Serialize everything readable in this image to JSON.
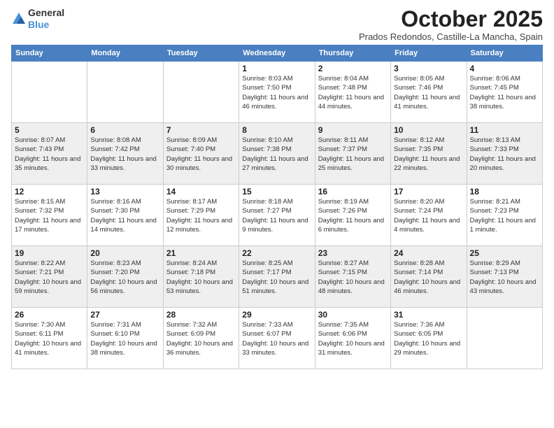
{
  "header": {
    "logo_line1": "General",
    "logo_line2": "Blue",
    "month": "October 2025",
    "location": "Prados Redondos, Castille-La Mancha, Spain"
  },
  "weekdays": [
    "Sunday",
    "Monday",
    "Tuesday",
    "Wednesday",
    "Thursday",
    "Friday",
    "Saturday"
  ],
  "weeks": [
    [
      {
        "day": "",
        "info": ""
      },
      {
        "day": "",
        "info": ""
      },
      {
        "day": "",
        "info": ""
      },
      {
        "day": "1",
        "info": "Sunrise: 8:03 AM\nSunset: 7:50 PM\nDaylight: 11 hours and 46 minutes."
      },
      {
        "day": "2",
        "info": "Sunrise: 8:04 AM\nSunset: 7:48 PM\nDaylight: 11 hours and 44 minutes."
      },
      {
        "day": "3",
        "info": "Sunrise: 8:05 AM\nSunset: 7:46 PM\nDaylight: 11 hours and 41 minutes."
      },
      {
        "day": "4",
        "info": "Sunrise: 8:06 AM\nSunset: 7:45 PM\nDaylight: 11 hours and 38 minutes."
      }
    ],
    [
      {
        "day": "5",
        "info": "Sunrise: 8:07 AM\nSunset: 7:43 PM\nDaylight: 11 hours and 35 minutes."
      },
      {
        "day": "6",
        "info": "Sunrise: 8:08 AM\nSunset: 7:42 PM\nDaylight: 11 hours and 33 minutes."
      },
      {
        "day": "7",
        "info": "Sunrise: 8:09 AM\nSunset: 7:40 PM\nDaylight: 11 hours and 30 minutes."
      },
      {
        "day": "8",
        "info": "Sunrise: 8:10 AM\nSunset: 7:38 PM\nDaylight: 11 hours and 27 minutes."
      },
      {
        "day": "9",
        "info": "Sunrise: 8:11 AM\nSunset: 7:37 PM\nDaylight: 11 hours and 25 minutes."
      },
      {
        "day": "10",
        "info": "Sunrise: 8:12 AM\nSunset: 7:35 PM\nDaylight: 11 hours and 22 minutes."
      },
      {
        "day": "11",
        "info": "Sunrise: 8:13 AM\nSunset: 7:33 PM\nDaylight: 11 hours and 20 minutes."
      }
    ],
    [
      {
        "day": "12",
        "info": "Sunrise: 8:15 AM\nSunset: 7:32 PM\nDaylight: 11 hours and 17 minutes."
      },
      {
        "day": "13",
        "info": "Sunrise: 8:16 AM\nSunset: 7:30 PM\nDaylight: 11 hours and 14 minutes."
      },
      {
        "day": "14",
        "info": "Sunrise: 8:17 AM\nSunset: 7:29 PM\nDaylight: 11 hours and 12 minutes."
      },
      {
        "day": "15",
        "info": "Sunrise: 8:18 AM\nSunset: 7:27 PM\nDaylight: 11 hours and 9 minutes."
      },
      {
        "day": "16",
        "info": "Sunrise: 8:19 AM\nSunset: 7:26 PM\nDaylight: 11 hours and 6 minutes."
      },
      {
        "day": "17",
        "info": "Sunrise: 8:20 AM\nSunset: 7:24 PM\nDaylight: 11 hours and 4 minutes."
      },
      {
        "day": "18",
        "info": "Sunrise: 8:21 AM\nSunset: 7:23 PM\nDaylight: 11 hours and 1 minute."
      }
    ],
    [
      {
        "day": "19",
        "info": "Sunrise: 8:22 AM\nSunset: 7:21 PM\nDaylight: 10 hours and 59 minutes."
      },
      {
        "day": "20",
        "info": "Sunrise: 8:23 AM\nSunset: 7:20 PM\nDaylight: 10 hours and 56 minutes."
      },
      {
        "day": "21",
        "info": "Sunrise: 8:24 AM\nSunset: 7:18 PM\nDaylight: 10 hours and 53 minutes."
      },
      {
        "day": "22",
        "info": "Sunrise: 8:25 AM\nSunset: 7:17 PM\nDaylight: 10 hours and 51 minutes."
      },
      {
        "day": "23",
        "info": "Sunrise: 8:27 AM\nSunset: 7:15 PM\nDaylight: 10 hours and 48 minutes."
      },
      {
        "day": "24",
        "info": "Sunrise: 8:28 AM\nSunset: 7:14 PM\nDaylight: 10 hours and 46 minutes."
      },
      {
        "day": "25",
        "info": "Sunrise: 8:29 AM\nSunset: 7:13 PM\nDaylight: 10 hours and 43 minutes."
      }
    ],
    [
      {
        "day": "26",
        "info": "Sunrise: 7:30 AM\nSunset: 6:11 PM\nDaylight: 10 hours and 41 minutes."
      },
      {
        "day": "27",
        "info": "Sunrise: 7:31 AM\nSunset: 6:10 PM\nDaylight: 10 hours and 38 minutes."
      },
      {
        "day": "28",
        "info": "Sunrise: 7:32 AM\nSunset: 6:09 PM\nDaylight: 10 hours and 36 minutes."
      },
      {
        "day": "29",
        "info": "Sunrise: 7:33 AM\nSunset: 6:07 PM\nDaylight: 10 hours and 33 minutes."
      },
      {
        "day": "30",
        "info": "Sunrise: 7:35 AM\nSunset: 6:06 PM\nDaylight: 10 hours and 31 minutes."
      },
      {
        "day": "31",
        "info": "Sunrise: 7:36 AM\nSunset: 6:05 PM\nDaylight: 10 hours and 29 minutes."
      },
      {
        "day": "",
        "info": ""
      }
    ]
  ]
}
